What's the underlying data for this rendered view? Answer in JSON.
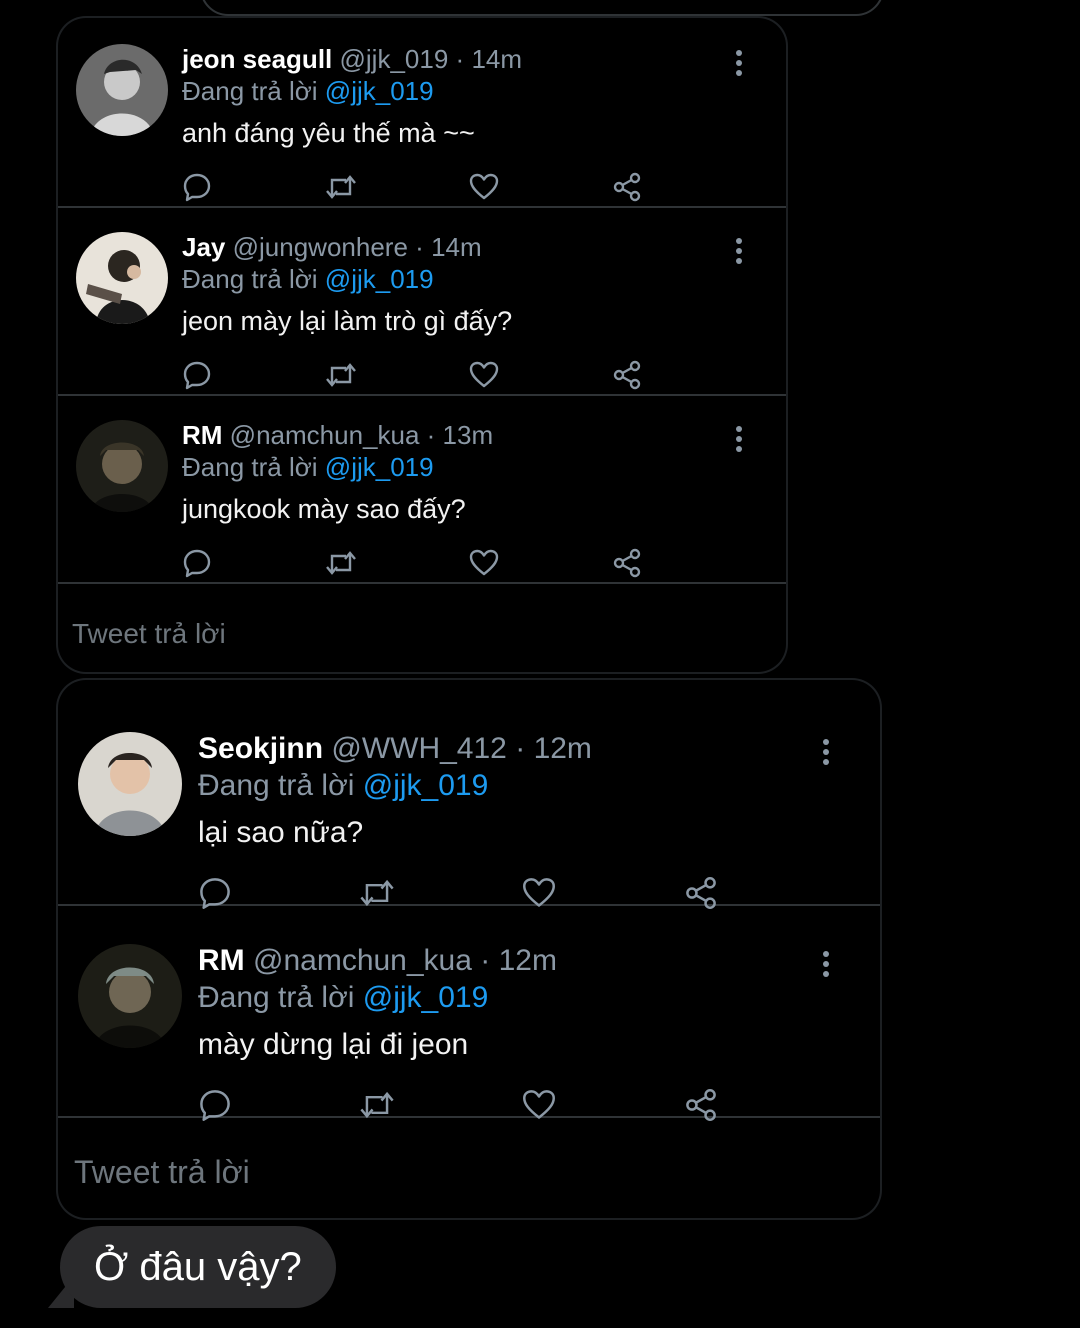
{
  "colors": {
    "background": "#000000",
    "accent_link": "#1d9bf0",
    "muted": "#8b98a5",
    "divider": "#2f3336",
    "bubble": "#2a2a2c"
  },
  "icons": {
    "reply": "reply-icon",
    "retweet": "retweet-icon",
    "like": "heart-icon",
    "share": "share-icon",
    "more": "more-vertical-icon"
  },
  "card1": {
    "tweets": [
      {
        "name": "jeon seagull",
        "handle": "@jjk_019",
        "separator": "·",
        "time": "14m",
        "reply_prefix": "Đang trả lời",
        "reply_to": "@jjk_019",
        "text": "anh đáng yêu thế mà ~~"
      },
      {
        "name": "Jay",
        "handle": "@jungwonhere",
        "separator": "·",
        "time": "14m",
        "reply_prefix": "Đang trả lời",
        "reply_to": "@jjk_019",
        "text": "jeon mày lại làm trò gì đấy?"
      },
      {
        "name": "RM",
        "handle": "@namchun_kua",
        "separator": "·",
        "time": "13m",
        "reply_prefix": "Đang trả lời",
        "reply_to": "@jjk_019",
        "text": "jungkook mày sao đấy?"
      }
    ],
    "reply_prompt": "Tweet trả lời"
  },
  "card2": {
    "tweets": [
      {
        "name": "Seokjinn",
        "handle": "@WWH_412",
        "separator": "·",
        "time": "12m",
        "reply_prefix": "Đang trả lời",
        "reply_to": "@jjk_019",
        "text": "lại sao nữa?"
      },
      {
        "name": "RM",
        "handle": "@namchun_kua",
        "separator": "·",
        "time": "12m",
        "reply_prefix": "Đang trả lời",
        "reply_to": "@jjk_019",
        "text": "mày dừng lại đi jeon"
      }
    ],
    "reply_prompt": "Tweet trả lời"
  },
  "message_bubble": {
    "text": "Ở đâu vậy?"
  }
}
